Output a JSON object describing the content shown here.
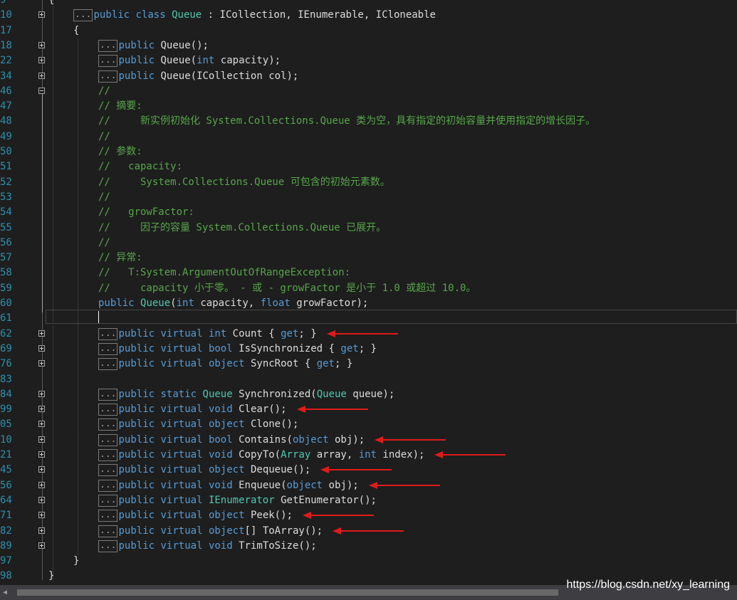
{
  "editor": {
    "lines": [
      {
        "num": "9",
        "fold": "",
        "indent": 0,
        "collapsed": false,
        "segments": [
          {
            "t": "{",
            "c": "p"
          }
        ]
      },
      {
        "num": "10",
        "fold": "plus",
        "indent": 1,
        "collapsed": true,
        "segments": [
          {
            "t": "public",
            "c": "kw"
          },
          {
            "t": " ",
            "c": "p"
          },
          {
            "t": "class",
            "c": "kw"
          },
          {
            "t": " ",
            "c": "p"
          },
          {
            "t": "Queue",
            "c": "ty"
          },
          {
            "t": " : ICollection, IEnumerable, ICloneable",
            "c": "p"
          }
        ]
      },
      {
        "num": "17",
        "fold": "",
        "indent": 1,
        "collapsed": false,
        "segments": [
          {
            "t": "{",
            "c": "p"
          }
        ]
      },
      {
        "num": "18",
        "fold": "plus",
        "indent": 2,
        "collapsed": true,
        "segments": [
          {
            "t": "public",
            "c": "kw"
          },
          {
            "t": " Queue();",
            "c": "p"
          }
        ]
      },
      {
        "num": "22",
        "fold": "plus",
        "indent": 2,
        "collapsed": true,
        "segments": [
          {
            "t": "public",
            "c": "kw"
          },
          {
            "t": " Queue(",
            "c": "p"
          },
          {
            "t": "int",
            "c": "kw"
          },
          {
            "t": " capacity);",
            "c": "p"
          }
        ]
      },
      {
        "num": "34",
        "fold": "plus",
        "indent": 2,
        "collapsed": true,
        "segments": [
          {
            "t": "public",
            "c": "kw"
          },
          {
            "t": " Queue(ICollection col);",
            "c": "p"
          }
        ]
      },
      {
        "num": "46",
        "fold": "minus",
        "indent": 2,
        "collapsed": false,
        "segments": [
          {
            "t": "//",
            "c": "cm"
          }
        ]
      },
      {
        "num": "47",
        "fold": "",
        "indent": 2,
        "collapsed": false,
        "segments": [
          {
            "t": "// 摘要:",
            "c": "cm"
          }
        ]
      },
      {
        "num": "48",
        "fold": "",
        "indent": 2,
        "collapsed": false,
        "segments": [
          {
            "t": "//     新实例初始化 System.Collections.Queue 类为空，具有指定的初始容量并使用指定的增长因子。",
            "c": "cm"
          }
        ]
      },
      {
        "num": "49",
        "fold": "",
        "indent": 2,
        "collapsed": false,
        "segments": [
          {
            "t": "//",
            "c": "cm"
          }
        ]
      },
      {
        "num": "50",
        "fold": "",
        "indent": 2,
        "collapsed": false,
        "segments": [
          {
            "t": "// 参数:",
            "c": "cm"
          }
        ]
      },
      {
        "num": "51",
        "fold": "",
        "indent": 2,
        "collapsed": false,
        "segments": [
          {
            "t": "//   capacity:",
            "c": "cm"
          }
        ]
      },
      {
        "num": "52",
        "fold": "",
        "indent": 2,
        "collapsed": false,
        "segments": [
          {
            "t": "//     System.Collections.Queue 可包含的初始元素数。",
            "c": "cm"
          }
        ]
      },
      {
        "num": "53",
        "fold": "",
        "indent": 2,
        "collapsed": false,
        "segments": [
          {
            "t": "//",
            "c": "cm"
          }
        ]
      },
      {
        "num": "54",
        "fold": "",
        "indent": 2,
        "collapsed": false,
        "segments": [
          {
            "t": "//   growFactor:",
            "c": "cm"
          }
        ]
      },
      {
        "num": "55",
        "fold": "",
        "indent": 2,
        "collapsed": false,
        "segments": [
          {
            "t": "//     因子的容量 System.Collections.Queue 已展开。",
            "c": "cm"
          }
        ]
      },
      {
        "num": "56",
        "fold": "",
        "indent": 2,
        "collapsed": false,
        "segments": [
          {
            "t": "//",
            "c": "cm"
          }
        ]
      },
      {
        "num": "57",
        "fold": "",
        "indent": 2,
        "collapsed": false,
        "segments": [
          {
            "t": "// 异常:",
            "c": "cm"
          }
        ]
      },
      {
        "num": "58",
        "fold": "",
        "indent": 2,
        "collapsed": false,
        "segments": [
          {
            "t": "//   T:System.ArgumentOutOfRangeException:",
            "c": "cm"
          }
        ]
      },
      {
        "num": "59",
        "fold": "",
        "indent": 2,
        "collapsed": false,
        "segments": [
          {
            "t": "//     capacity 小于零。 - 或 - growFactor 是小于 1.0 或超过 10.0。",
            "c": "cm"
          }
        ]
      },
      {
        "num": "60",
        "fold": "",
        "indent": 2,
        "collapsed": false,
        "segments": [
          {
            "t": "public",
            "c": "kw"
          },
          {
            "t": " ",
            "c": "p"
          },
          {
            "t": "Queue",
            "c": "ty"
          },
          {
            "t": "(",
            "c": "p"
          },
          {
            "t": "int",
            "c": "kw"
          },
          {
            "t": " capacity, ",
            "c": "p"
          },
          {
            "t": "float",
            "c": "kw"
          },
          {
            "t": " growFactor);",
            "c": "p"
          }
        ]
      },
      {
        "num": "61",
        "fold": "",
        "indent": 2,
        "collapsed": false,
        "segments": []
      },
      {
        "num": "62",
        "fold": "plus",
        "indent": 2,
        "collapsed": true,
        "segments": [
          {
            "t": "public",
            "c": "kw"
          },
          {
            "t": " ",
            "c": "p"
          },
          {
            "t": "virtual",
            "c": "kw"
          },
          {
            "t": " ",
            "c": "p"
          },
          {
            "t": "int",
            "c": "kw"
          },
          {
            "t": " Count { ",
            "c": "p"
          },
          {
            "t": "get",
            "c": "kw"
          },
          {
            "t": "; }",
            "c": "p"
          }
        ]
      },
      {
        "num": "69",
        "fold": "plus",
        "indent": 2,
        "collapsed": true,
        "segments": [
          {
            "t": "public",
            "c": "kw"
          },
          {
            "t": " ",
            "c": "p"
          },
          {
            "t": "virtual",
            "c": "kw"
          },
          {
            "t": " ",
            "c": "p"
          },
          {
            "t": "bool",
            "c": "kw"
          },
          {
            "t": " IsSynchronized { ",
            "c": "p"
          },
          {
            "t": "get",
            "c": "kw"
          },
          {
            "t": "; }",
            "c": "p"
          }
        ]
      },
      {
        "num": "76",
        "fold": "plus",
        "indent": 2,
        "collapsed": true,
        "segments": [
          {
            "t": "public",
            "c": "kw"
          },
          {
            "t": " ",
            "c": "p"
          },
          {
            "t": "virtual",
            "c": "kw"
          },
          {
            "t": " ",
            "c": "p"
          },
          {
            "t": "object",
            "c": "kw"
          },
          {
            "t": " SyncRoot { ",
            "c": "p"
          },
          {
            "t": "get",
            "c": "kw"
          },
          {
            "t": "; }",
            "c": "p"
          }
        ]
      },
      {
        "num": "83",
        "fold": "",
        "indent": 2,
        "collapsed": false,
        "segments": []
      },
      {
        "num": "84",
        "fold": "plus",
        "indent": 2,
        "collapsed": true,
        "segments": [
          {
            "t": "public",
            "c": "kw"
          },
          {
            "t": " ",
            "c": "p"
          },
          {
            "t": "static",
            "c": "kw"
          },
          {
            "t": " ",
            "c": "p"
          },
          {
            "t": "Queue",
            "c": "ty"
          },
          {
            "t": " Synchronized(",
            "c": "p"
          },
          {
            "t": "Queue",
            "c": "ty"
          },
          {
            "t": " queue);",
            "c": "p"
          }
        ]
      },
      {
        "num": "99",
        "fold": "plus",
        "indent": 2,
        "collapsed": true,
        "segments": [
          {
            "t": "public",
            "c": "kw"
          },
          {
            "t": " ",
            "c": "p"
          },
          {
            "t": "virtual",
            "c": "kw"
          },
          {
            "t": " ",
            "c": "p"
          },
          {
            "t": "void",
            "c": "kw"
          },
          {
            "t": " Clear();",
            "c": "p"
          }
        ]
      },
      {
        "num": "05",
        "fold": "plus",
        "indent": 2,
        "collapsed": true,
        "segments": [
          {
            "t": "public",
            "c": "kw"
          },
          {
            "t": " ",
            "c": "p"
          },
          {
            "t": "virtual",
            "c": "kw"
          },
          {
            "t": " ",
            "c": "p"
          },
          {
            "t": "object",
            "c": "kw"
          },
          {
            "t": " Clone();",
            "c": "p"
          }
        ]
      },
      {
        "num": "10",
        "fold": "plus",
        "indent": 2,
        "collapsed": true,
        "segments": [
          {
            "t": "public",
            "c": "kw"
          },
          {
            "t": " ",
            "c": "p"
          },
          {
            "t": "virtual",
            "c": "kw"
          },
          {
            "t": " ",
            "c": "p"
          },
          {
            "t": "bool",
            "c": "kw"
          },
          {
            "t": " Contains(",
            "c": "p"
          },
          {
            "t": "object",
            "c": "kw"
          },
          {
            "t": " obj);",
            "c": "p"
          }
        ]
      },
      {
        "num": "21",
        "fold": "plus",
        "indent": 2,
        "collapsed": true,
        "segments": [
          {
            "t": "public",
            "c": "kw"
          },
          {
            "t": " ",
            "c": "p"
          },
          {
            "t": "virtual",
            "c": "kw"
          },
          {
            "t": " ",
            "c": "p"
          },
          {
            "t": "void",
            "c": "kw"
          },
          {
            "t": " CopyTo(",
            "c": "p"
          },
          {
            "t": "Array",
            "c": "ty"
          },
          {
            "t": " array, ",
            "c": "p"
          },
          {
            "t": "int",
            "c": "kw"
          },
          {
            "t": " index);",
            "c": "p"
          }
        ]
      },
      {
        "num": "45",
        "fold": "plus",
        "indent": 2,
        "collapsed": true,
        "segments": [
          {
            "t": "public",
            "c": "kw"
          },
          {
            "t": " ",
            "c": "p"
          },
          {
            "t": "virtual",
            "c": "kw"
          },
          {
            "t": " ",
            "c": "p"
          },
          {
            "t": "object",
            "c": "kw"
          },
          {
            "t": " Dequeue();",
            "c": "p"
          }
        ]
      },
      {
        "num": "56",
        "fold": "plus",
        "indent": 2,
        "collapsed": true,
        "segments": [
          {
            "t": "public",
            "c": "kw"
          },
          {
            "t": " ",
            "c": "p"
          },
          {
            "t": "virtual",
            "c": "kw"
          },
          {
            "t": " ",
            "c": "p"
          },
          {
            "t": "void",
            "c": "kw"
          },
          {
            "t": " Enqueue(",
            "c": "p"
          },
          {
            "t": "object",
            "c": "kw"
          },
          {
            "t": " obj);",
            "c": "p"
          }
        ]
      },
      {
        "num": "64",
        "fold": "plus",
        "indent": 2,
        "collapsed": true,
        "segments": [
          {
            "t": "public",
            "c": "kw"
          },
          {
            "t": " ",
            "c": "p"
          },
          {
            "t": "virtual",
            "c": "kw"
          },
          {
            "t": " ",
            "c": "p"
          },
          {
            "t": "IEnumerator",
            "c": "ty"
          },
          {
            "t": " GetEnumerator();",
            "c": "p"
          }
        ]
      },
      {
        "num": "71",
        "fold": "plus",
        "indent": 2,
        "collapsed": true,
        "segments": [
          {
            "t": "public",
            "c": "kw"
          },
          {
            "t": " ",
            "c": "p"
          },
          {
            "t": "virtual",
            "c": "kw"
          },
          {
            "t": " ",
            "c": "p"
          },
          {
            "t": "object",
            "c": "kw"
          },
          {
            "t": " Peek();",
            "c": "p"
          }
        ]
      },
      {
        "num": "82",
        "fold": "plus",
        "indent": 2,
        "collapsed": true,
        "segments": [
          {
            "t": "public",
            "c": "kw"
          },
          {
            "t": " ",
            "c": "p"
          },
          {
            "t": "virtual",
            "c": "kw"
          },
          {
            "t": " ",
            "c": "p"
          },
          {
            "t": "object",
            "c": "kw"
          },
          {
            "t": "[] ToArray();",
            "c": "p"
          }
        ]
      },
      {
        "num": "89",
        "fold": "plus",
        "indent": 2,
        "collapsed": true,
        "segments": [
          {
            "t": "public",
            "c": "kw"
          },
          {
            "t": " ",
            "c": "p"
          },
          {
            "t": "virtual",
            "c": "kw"
          },
          {
            "t": " ",
            "c": "p"
          },
          {
            "t": "void",
            "c": "kw"
          },
          {
            "t": " TrimToSize();",
            "c": "p"
          }
        ]
      },
      {
        "num": "97",
        "fold": "",
        "indent": 1,
        "collapsed": false,
        "segments": [
          {
            "t": "}",
            "c": "p"
          }
        ]
      },
      {
        "num": "98",
        "fold": "",
        "indent": 0,
        "collapsed": false,
        "segments": [
          {
            "t": "}",
            "c": "p"
          }
        ]
      }
    ],
    "collapsed_label": "...",
    "annotation_arrows": [
      "Count",
      "Clear",
      "Contains",
      "CopyTo",
      "Dequeue",
      "Enqueue",
      "Peek",
      "ToArray"
    ]
  },
  "watermark": "https://blog.csdn.net/xy_learning",
  "colors": {
    "background": "#1e1e1e",
    "keyword": "#569cd6",
    "type": "#4ec9b0",
    "comment": "#57a64a",
    "plain": "#dcdcdc",
    "line_number": "#2b91af",
    "arrow": "#e01a1a"
  }
}
